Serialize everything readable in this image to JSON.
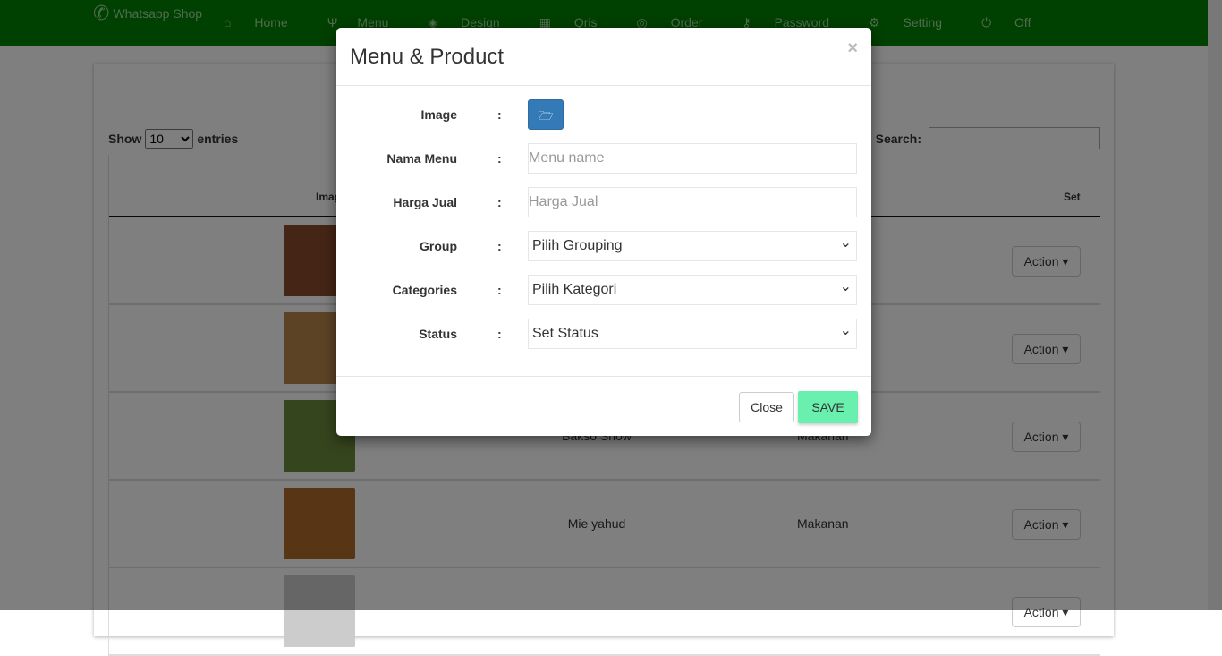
{
  "navbar": {
    "brand": "Whatsapp Shop",
    "items": [
      {
        "label": "Home",
        "icon": "home-icon"
      },
      {
        "label": "Menu",
        "icon": "cutlery-icon"
      },
      {
        "label": "Design",
        "icon": "design-icon"
      },
      {
        "label": "Qris",
        "icon": "qrcode-icon"
      },
      {
        "label": "Order",
        "icon": "search-icon"
      },
      {
        "label": "Password",
        "icon": "key-icon"
      },
      {
        "label": "Setting",
        "icon": "gears-icon"
      },
      {
        "label": "Off",
        "icon": "power-icon"
      }
    ],
    "color": "#008000"
  },
  "table": {
    "show_label": "Show",
    "entries_value": "10",
    "entries_label": "entries",
    "search_label": "Search:",
    "columns": [
      "Image",
      "Set"
    ],
    "rows": [
      {
        "name": "",
        "category": "",
        "action": "Action",
        "color": "#8a4a2a"
      },
      {
        "name": "",
        "category": "",
        "action": "Action",
        "color": "#b8864a"
      },
      {
        "name": "Bakso Snow",
        "category": "Makanan",
        "action": "Action",
        "color": "#6a8a3a"
      },
      {
        "name": "Mie yahud",
        "category": "Makanan",
        "action": "Action",
        "color": "#b06a2a"
      },
      {
        "name": "",
        "category": "",
        "action": "Action",
        "color": "#ccc"
      }
    ]
  },
  "modal": {
    "title": "Menu & Product",
    "close_x": "×",
    "fields": [
      {
        "label": "Image"
      },
      {
        "label": "Nama Menu",
        "placeholder": "Menu name"
      },
      {
        "label": "Harga Jual",
        "placeholder": "Harga Jual"
      },
      {
        "label": "Group",
        "value": "Pilih Grouping"
      },
      {
        "label": "Categories",
        "value": "Pilih Kategori"
      },
      {
        "label": "Status",
        "value": "Set Status"
      }
    ],
    "colon": ":",
    "close_label": "Close",
    "save_label": "SAVE",
    "save_color": "#69f0ae"
  }
}
